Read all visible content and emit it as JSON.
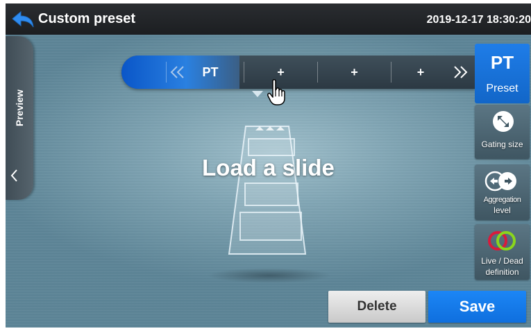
{
  "header": {
    "title": "Custom preset",
    "datetime": "2019-12-17 18:30:20"
  },
  "preview_tab": {
    "label": "Preview"
  },
  "preset_strip": {
    "slots": [
      "PT",
      "+",
      "+",
      "+"
    ],
    "selected_index": 0
  },
  "main": {
    "message": "Load a slide"
  },
  "side_panel": {
    "preset": {
      "code": "PT",
      "label": "Preset"
    },
    "gating_size": {
      "label": "Gating size"
    },
    "aggregation": {
      "line1": "Aggregation",
      "line2": "level"
    },
    "live_dead": {
      "line1": "Live / Dead",
      "line2": "definition"
    }
  },
  "footer": {
    "delete_label": "Delete",
    "save_label": "Save"
  },
  "colors": {
    "accent_blue": "#1a78e8",
    "title_bar": "#222428",
    "live_ring": "#d81b3c",
    "dead_ring": "#8bd61c"
  },
  "icons": [
    "back-arrow-icon",
    "chevron-left-icon",
    "double-chevron-left-icon",
    "double-chevron-right-icon",
    "hand-cursor-icon",
    "resize-arrows-icon",
    "aggregation-arrows-icon",
    "rings-icon"
  ]
}
